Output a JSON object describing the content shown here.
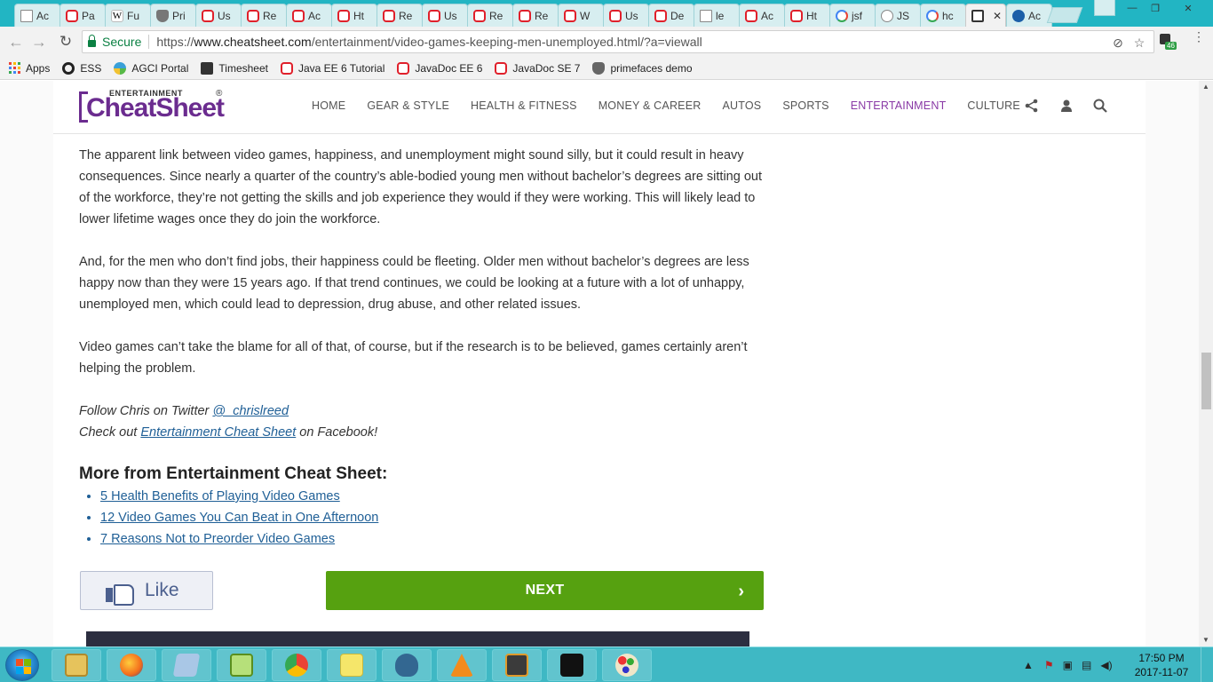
{
  "browser": {
    "tabs": [
      {
        "title": "Ac",
        "icon": "doc"
      },
      {
        "title": "Pa",
        "icon": "oracle"
      },
      {
        "title": "Fu",
        "icon": "w"
      },
      {
        "title": "Pri",
        "icon": "shield"
      },
      {
        "title": "Us",
        "icon": "oracle"
      },
      {
        "title": "Re",
        "icon": "oracle"
      },
      {
        "title": "Ac",
        "icon": "oracle"
      },
      {
        "title": "Ht",
        "icon": "oracle"
      },
      {
        "title": "Re",
        "icon": "oracle"
      },
      {
        "title": "Us",
        "icon": "oracle"
      },
      {
        "title": "Re",
        "icon": "oracle"
      },
      {
        "title": "Re",
        "icon": "oracle"
      },
      {
        "title": "W",
        "icon": "oracle"
      },
      {
        "title": "Us",
        "icon": "oracle"
      },
      {
        "title": "De",
        "icon": "oracle"
      },
      {
        "title": "le",
        "icon": "doc"
      },
      {
        "title": "Ac",
        "icon": "oracle"
      },
      {
        "title": "Ht",
        "icon": "oracle"
      },
      {
        "title": "jsf",
        "icon": "g"
      },
      {
        "title": "JS",
        "icon": "q"
      },
      {
        "title": "hc",
        "icon": "g"
      },
      {
        "title": "",
        "icon": "cs",
        "active": true
      },
      {
        "title": "Ac",
        "icon": "ac"
      }
    ],
    "active_tab_close": "✕",
    "window_controls": {
      "minimize": "—",
      "maximize": "❐",
      "close": "✕"
    },
    "nav": {
      "back": "←",
      "forward": "→",
      "reload": "↻"
    },
    "secure_label": "Secure",
    "url_prefix": "https://",
    "url_domain": "www.cheatsheet.com",
    "url_path": "/entertainment/video-games-keeping-men-unemployed.html/?a=viewall",
    "extension_badge": "46",
    "menu_icon": "⋮",
    "star_icon": "☆"
  },
  "bookmarks": [
    {
      "label": "Apps",
      "icon": "apps"
    },
    {
      "label": "ESS",
      "icon": "ess"
    },
    {
      "label": "AGCI Portal",
      "icon": "agci"
    },
    {
      "label": "Timesheet",
      "icon": "ts"
    },
    {
      "label": "Java EE 6 Tutorial",
      "icon": "orc"
    },
    {
      "label": "JavaDoc EE 6",
      "icon": "orc"
    },
    {
      "label": "JavaDoc SE 7",
      "icon": "orc"
    },
    {
      "label": "primefaces demo",
      "icon": "pf"
    }
  ],
  "site": {
    "logo_small": "ENTERTAINMENT",
    "logo_big": "CheatSheet",
    "logo_reg": "®",
    "nav": [
      {
        "label": "HOME",
        "active": false
      },
      {
        "label": "GEAR & STYLE",
        "active": false
      },
      {
        "label": "HEALTH & FITNESS",
        "active": false
      },
      {
        "label": "MONEY & CAREER",
        "active": false
      },
      {
        "label": "AUTOS",
        "active": false
      },
      {
        "label": "SPORTS",
        "active": false
      },
      {
        "label": "ENTERTAINMENT",
        "active": true
      },
      {
        "label": "CULTURE",
        "active": false
      }
    ],
    "colors": {
      "brand_purple": "#6b2c8f",
      "active_nav": "#8a3aa6",
      "next_green": "#56a110",
      "link": "#1f5f96"
    }
  },
  "article": {
    "para1": "The apparent link between video games, happiness, and unemployment might sound silly, but it could result in heavy consequences. Since nearly a quarter of the country’s able-bodied young men without bachelor’s degrees are sitting out of the workforce, they’re not getting the skills and job experience they would if they were working. This will likely lead to lower lifetime wages once they do join the workforce.",
    "para2": "And, for the men who don’t find jobs, their happiness could be fleeting. Older men without bachelor’s degrees are less happy now than they were 15 years ago. If that trend continues, we could be looking at a future with a lot of unhappy, unemployed men, which could lead to depression, drug abuse, and other related issues.",
    "para3": "Video games can’t take the blame for all of that, of course, but if the research is to be believed, games certainly aren’t helping the problem.",
    "follow_prefix": "Follow Chris on Twitter ",
    "follow_handle": "@_chrislreed",
    "checkout_prefix": "Check out ",
    "checkout_link": "Entertainment Cheat Sheet",
    "checkout_suffix": " on Facebook!",
    "more_title": "More from Entertainment Cheat Sheet:",
    "more_links": [
      "5 Health Benefits of Playing Video Games",
      "12 Video Games You Can Beat in One Afternoon",
      "7 Reasons Not to Preorder Video Games"
    ],
    "like_label": "Like",
    "next_label": "NEXT",
    "next_chevron": "›"
  },
  "taskbar": {
    "apps": [
      "explorer",
      "firefox",
      "notepad",
      "notepad-plus",
      "chrome",
      "sticky-notes",
      "postgres",
      "vlc",
      "java-ee-ide",
      "eclipse",
      "paint"
    ],
    "clock_time": "17:50 PM",
    "clock_date": "2017-11-07"
  }
}
